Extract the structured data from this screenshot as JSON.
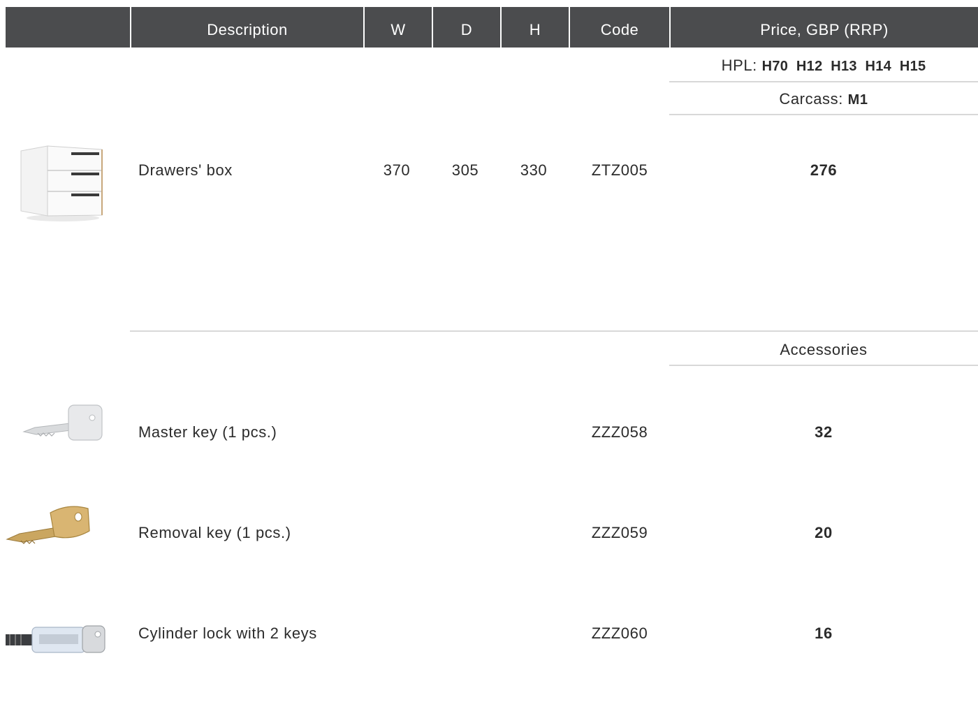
{
  "header": {
    "description": "Description",
    "w": "W",
    "d": "D",
    "h": "H",
    "code": "Code",
    "price": "Price, GBP (RRP)"
  },
  "price_header": {
    "hpl_label": "HPL:",
    "hpl_codes": "H70  H12  H13  H14  H15",
    "carcass_label": "Carcass:",
    "carcass_code": "M1"
  },
  "main_product": {
    "image_icon": "drawer-box-image",
    "description": "Drawers' box",
    "w": "370",
    "d": "305",
    "h": "330",
    "code": "ZTZ005",
    "price": "276"
  },
  "accessories": {
    "heading": "Accessories",
    "items": [
      {
        "image_icon": "master-key-image",
        "description": "Master key (1 pcs.)",
        "code": "ZZZ058",
        "price": "32"
      },
      {
        "image_icon": "removal-key-image",
        "description": "Removal key (1 pcs.)",
        "code": "ZZZ059",
        "price": "20"
      },
      {
        "image_icon": "cylinder-lock-image",
        "description": "Cylinder lock with 2 keys",
        "code": "ZZZ060",
        "price": "16"
      }
    ]
  }
}
